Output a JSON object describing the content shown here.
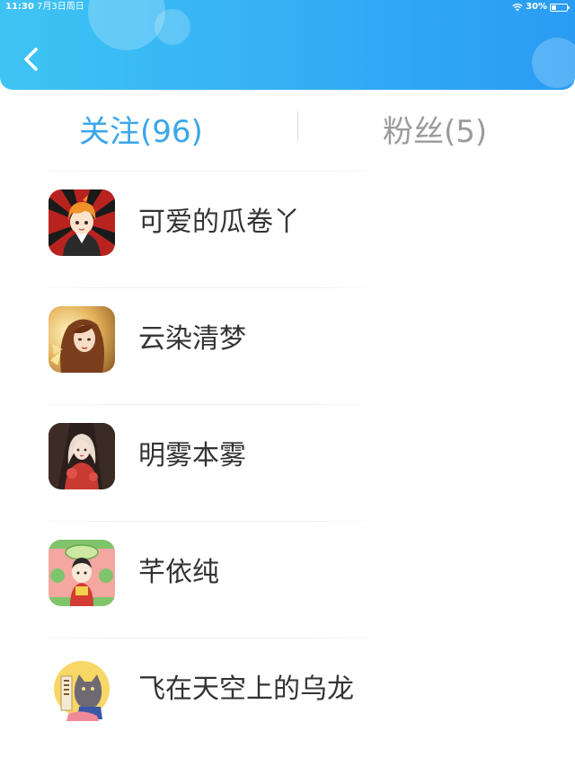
{
  "status_bar": {
    "time": "11:30",
    "date": "7月3日周日",
    "battery": "30%",
    "battery_level": 0.3
  },
  "header": {
    "back_icon": "chevron-left-icon"
  },
  "tabs": [
    {
      "label": "关注(96)",
      "active": true
    },
    {
      "label": "粉丝(5)",
      "active": false
    }
  ],
  "follow_list": [
    {
      "name": "可爱的瓜卷丫",
      "avatar_icon": "avatar-anime-boy"
    },
    {
      "name": "云染清梦",
      "avatar_icon": "avatar-golden-lady"
    },
    {
      "name": "明雾本雾",
      "avatar_icon": "avatar-red-dress-girl"
    },
    {
      "name": "芊依纯",
      "avatar_icon": "avatar-green-cartoon"
    },
    {
      "name": "飞在天空上的乌龙",
      "avatar_icon": "avatar-gray-cat"
    }
  ],
  "colors": {
    "header_start": "#3ec4f3",
    "header_end": "#2a9cf4",
    "active_tab": "#3aa6ea",
    "inactive_tab": "#9b9b9b",
    "name_text": "#333333"
  }
}
